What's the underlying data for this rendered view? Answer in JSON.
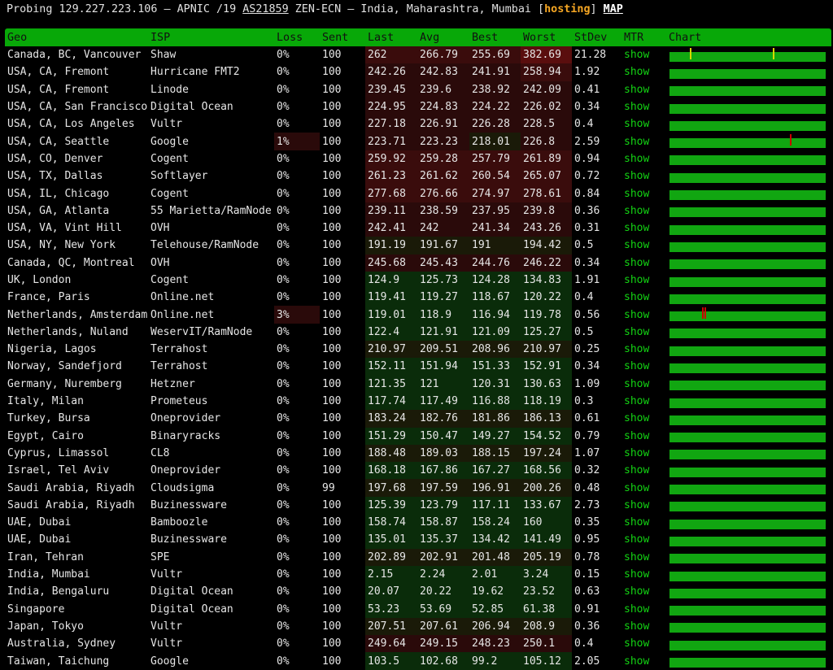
{
  "header": {
    "prefix": "Probing 129.227.223.106 — APNIC /19 ",
    "asn": "AS21859",
    "middle": " ZEN-ECN — India, Maharashtra, Mumbai [",
    "tag": "hosting",
    "close": "] ",
    "map": "MAP"
  },
  "columns": [
    "Geo",
    "ISP",
    "Loss",
    "Sent",
    "Last",
    "Avg",
    "Best",
    "Worst",
    "StDev",
    "MTR",
    "Chart"
  ],
  "mtr_label": "show",
  "colors": {
    "header_green": "#08a808",
    "chart_green": "#11a611",
    "mtr_link": "#13d313",
    "hosting_tag": "#f5a623",
    "fast_cell": "#0a2c0a",
    "slow_cell": "#3a0c0c"
  },
  "rows": [
    {
      "geo": "Canada, BC, Vancouver",
      "isp": "Shaw",
      "loss": "0%",
      "sent": "100",
      "last": "262",
      "avg": "266.79",
      "best": "255.69",
      "worst": "382.69",
      "stdev": "21.28",
      "marks": [
        {
          "pos": 0.13,
          "color": "#d8d800"
        },
        {
          "pos": 0.66,
          "color": "#d8d800"
        }
      ]
    },
    {
      "geo": "USA, CA, Fremont",
      "isp": "Hurricane FMT2",
      "loss": "0%",
      "sent": "100",
      "last": "242.26",
      "avg": "242.83",
      "best": "241.91",
      "worst": "258.94",
      "stdev": "1.92",
      "marks": []
    },
    {
      "geo": "USA, CA, Fremont",
      "isp": "Linode",
      "loss": "0%",
      "sent": "100",
      "last": "239.45",
      "avg": "239.6",
      "best": "238.92",
      "worst": "242.09",
      "stdev": "0.41",
      "marks": []
    },
    {
      "geo": "USA, CA, San Francisco",
      "isp": "Digital Ocean",
      "loss": "0%",
      "sent": "100",
      "last": "224.95",
      "avg": "224.83",
      "best": "224.22",
      "worst": "226.02",
      "stdev": "0.34",
      "marks": []
    },
    {
      "geo": "USA, CA, Los Angeles",
      "isp": "Vultr",
      "loss": "0%",
      "sent": "100",
      "last": "227.18",
      "avg": "226.91",
      "best": "226.28",
      "worst": "228.5",
      "stdev": "0.4",
      "marks": []
    },
    {
      "geo": "USA, CA, Seattle",
      "isp": "Google",
      "loss": "1%",
      "sent": "100",
      "last": "223.71",
      "avg": "223.23",
      "best": "218.01",
      "worst": "226.8",
      "stdev": "2.59",
      "marks": [
        {
          "pos": 0.77,
          "color": "#cc0000"
        }
      ]
    },
    {
      "geo": "USA, CO, Denver",
      "isp": "Cogent",
      "loss": "0%",
      "sent": "100",
      "last": "259.92",
      "avg": "259.28",
      "best": "257.79",
      "worst": "261.89",
      "stdev": "0.94",
      "marks": []
    },
    {
      "geo": "USA, TX, Dallas",
      "isp": "Softlayer",
      "loss": "0%",
      "sent": "100",
      "last": "261.23",
      "avg": "261.62",
      "best": "260.54",
      "worst": "265.07",
      "stdev": "0.72",
      "marks": []
    },
    {
      "geo": "USA, IL, Chicago",
      "isp": "Cogent",
      "loss": "0%",
      "sent": "100",
      "last": "277.68",
      "avg": "276.66",
      "best": "274.97",
      "worst": "278.61",
      "stdev": "0.84",
      "marks": []
    },
    {
      "geo": "USA, GA, Atlanta",
      "isp": "55 Marietta/RamNode",
      "loss": "0%",
      "sent": "100",
      "last": "239.11",
      "avg": "238.59",
      "best": "237.95",
      "worst": "239.8",
      "stdev": "0.36",
      "marks": []
    },
    {
      "geo": "USA, VA, Vint Hill",
      "isp": "OVH",
      "loss": "0%",
      "sent": "100",
      "last": "242.41",
      "avg": "242",
      "best": "241.34",
      "worst": "243.26",
      "stdev": "0.31",
      "marks": []
    },
    {
      "geo": "USA, NY, New York",
      "isp": "Telehouse/RamNode",
      "loss": "0%",
      "sent": "100",
      "last": "191.19",
      "avg": "191.67",
      "best": "191",
      "worst": "194.42",
      "stdev": "0.5",
      "marks": []
    },
    {
      "geo": "Canada, QC, Montreal",
      "isp": "OVH",
      "loss": "0%",
      "sent": "100",
      "last": "245.68",
      "avg": "245.43",
      "best": "244.76",
      "worst": "246.22",
      "stdev": "0.34",
      "marks": []
    },
    {
      "geo": "UK, London",
      "isp": "Cogent",
      "loss": "0%",
      "sent": "100",
      "last": "124.9",
      "avg": "125.73",
      "best": "124.28",
      "worst": "134.83",
      "stdev": "1.91",
      "marks": []
    },
    {
      "geo": "France, Paris",
      "isp": "Online.net",
      "loss": "0%",
      "sent": "100",
      "last": "119.41",
      "avg": "119.27",
      "best": "118.67",
      "worst": "120.22",
      "stdev": "0.4",
      "marks": []
    },
    {
      "geo": "Netherlands, Amsterdam",
      "isp": "Online.net",
      "loss": "3%",
      "sent": "100",
      "last": "119.01",
      "avg": "118.9",
      "best": "116.94",
      "worst": "119.78",
      "stdev": "0.56",
      "marks": [
        {
          "pos": 0.21,
          "color": "#cc0000"
        },
        {
          "pos": 0.225,
          "color": "#cc0000"
        }
      ]
    },
    {
      "geo": "Netherlands, Nuland",
      "isp": "WeservIT/RamNode",
      "loss": "0%",
      "sent": "100",
      "last": "122.4",
      "avg": "121.91",
      "best": "121.09",
      "worst": "125.27",
      "stdev": "0.5",
      "marks": []
    },
    {
      "geo": "Nigeria, Lagos",
      "isp": "Terrahost",
      "loss": "0%",
      "sent": "100",
      "last": "210.97",
      "avg": "209.51",
      "best": "208.96",
      "worst": "210.97",
      "stdev": "0.25",
      "marks": []
    },
    {
      "geo": "Norway, Sandefjord",
      "isp": "Terrahost",
      "loss": "0%",
      "sent": "100",
      "last": "152.11",
      "avg": "151.94",
      "best": "151.33",
      "worst": "152.91",
      "stdev": "0.34",
      "marks": []
    },
    {
      "geo": "Germany, Nuremberg",
      "isp": "Hetzner",
      "loss": "0%",
      "sent": "100",
      "last": "121.35",
      "avg": "121",
      "best": "120.31",
      "worst": "130.63",
      "stdev": "1.09",
      "marks": []
    },
    {
      "geo": "Italy, Milan",
      "isp": "Prometeus",
      "loss": "0%",
      "sent": "100",
      "last": "117.74",
      "avg": "117.49",
      "best": "116.88",
      "worst": "118.19",
      "stdev": "0.3",
      "marks": []
    },
    {
      "geo": "Turkey, Bursa",
      "isp": "Oneprovider",
      "loss": "0%",
      "sent": "100",
      "last": "183.24",
      "avg": "182.76",
      "best": "181.86",
      "worst": "186.13",
      "stdev": "0.61",
      "marks": []
    },
    {
      "geo": "Egypt, Cairo",
      "isp": "Binaryracks",
      "loss": "0%",
      "sent": "100",
      "last": "151.29",
      "avg": "150.47",
      "best": "149.27",
      "worst": "154.52",
      "stdev": "0.79",
      "marks": []
    },
    {
      "geo": "Cyprus, Limassol",
      "isp": "CL8",
      "loss": "0%",
      "sent": "100",
      "last": "188.48",
      "avg": "189.03",
      "best": "188.15",
      "worst": "197.24",
      "stdev": "1.07",
      "marks": []
    },
    {
      "geo": "Israel, Tel Aviv",
      "isp": "Oneprovider",
      "loss": "0%",
      "sent": "100",
      "last": "168.18",
      "avg": "167.86",
      "best": "167.27",
      "worst": "168.56",
      "stdev": "0.32",
      "marks": []
    },
    {
      "geo": "Saudi Arabia, Riyadh",
      "isp": "Cloudsigma",
      "loss": "0%",
      "sent": "99",
      "last": "197.68",
      "avg": "197.59",
      "best": "196.91",
      "worst": "200.26",
      "stdev": "0.48",
      "marks": []
    },
    {
      "geo": "Saudi Arabia, Riyadh",
      "isp": "Buzinessware",
      "loss": "0%",
      "sent": "100",
      "last": "125.39",
      "avg": "123.79",
      "best": "117.11",
      "worst": "133.67",
      "stdev": "2.73",
      "marks": []
    },
    {
      "geo": "UAE, Dubai",
      "isp": "Bamboozle",
      "loss": "0%",
      "sent": "100",
      "last": "158.74",
      "avg": "158.87",
      "best": "158.24",
      "worst": "160",
      "stdev": "0.35",
      "marks": []
    },
    {
      "geo": "UAE, Dubai",
      "isp": "Buzinessware",
      "loss": "0%",
      "sent": "100",
      "last": "135.01",
      "avg": "135.37",
      "best": "134.42",
      "worst": "141.49",
      "stdev": "0.95",
      "marks": []
    },
    {
      "geo": "Iran, Tehran",
      "isp": "SPE",
      "loss": "0%",
      "sent": "100",
      "last": "202.89",
      "avg": "202.91",
      "best": "201.48",
      "worst": "205.19",
      "stdev": "0.78",
      "marks": []
    },
    {
      "geo": "India, Mumbai",
      "isp": "Vultr",
      "loss": "0%",
      "sent": "100",
      "last": "2.15",
      "avg": "2.24",
      "best": "2.01",
      "worst": "3.24",
      "stdev": "0.15",
      "marks": []
    },
    {
      "geo": "India, Bengaluru",
      "isp": "Digital Ocean",
      "loss": "0%",
      "sent": "100",
      "last": "20.07",
      "avg": "20.22",
      "best": "19.62",
      "worst": "23.52",
      "stdev": "0.63",
      "marks": []
    },
    {
      "geo": "Singapore",
      "isp": "Digital Ocean",
      "loss": "0%",
      "sent": "100",
      "last": "53.23",
      "avg": "53.69",
      "best": "52.85",
      "worst": "61.38",
      "stdev": "0.91",
      "marks": []
    },
    {
      "geo": "Japan, Tokyo",
      "isp": "Vultr",
      "loss": "0%",
      "sent": "100",
      "last": "207.51",
      "avg": "207.61",
      "best": "206.94",
      "worst": "208.9",
      "stdev": "0.36",
      "marks": []
    },
    {
      "geo": "Australia, Sydney",
      "isp": "Vultr",
      "loss": "0%",
      "sent": "100",
      "last": "249.64",
      "avg": "249.15",
      "best": "248.23",
      "worst": "250.1",
      "stdev": "0.4",
      "marks": []
    },
    {
      "geo": "Taiwan, Taichung",
      "isp": "Google",
      "loss": "0%",
      "sent": "100",
      "last": "103.5",
      "avg": "102.68",
      "best": "99.2",
      "worst": "105.12",
      "stdev": "2.05",
      "marks": []
    }
  ]
}
